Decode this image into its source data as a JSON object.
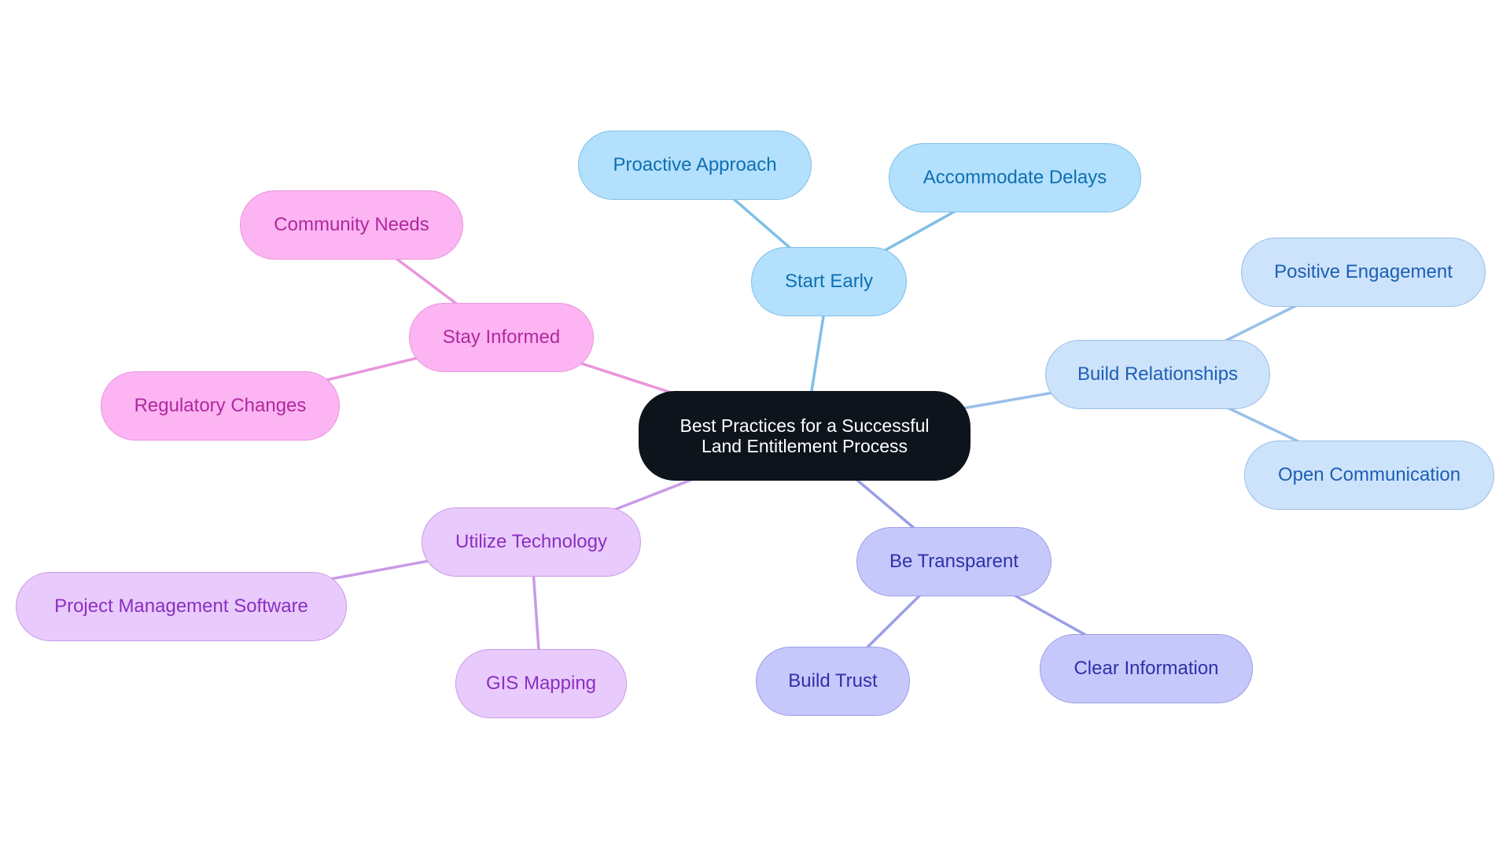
{
  "diagram": {
    "type": "mindmap",
    "root": {
      "id": "root",
      "label_lines": [
        "Best Practices for a Successful",
        "Land Entitlement Process"
      ],
      "theme": "dark"
    },
    "themes": {
      "dark": {
        "fill": "#0d141c",
        "stroke": "#0d141c",
        "text": "#ffffff",
        "edge": "#0d141c"
      },
      "sky": {
        "fill": "#b3e0fd",
        "stroke": "#7fbfe6",
        "text": "#0f6fb0",
        "edge": "#7fbfe6"
      },
      "azure": {
        "fill": "#cde3fb",
        "stroke": "#98bfe8",
        "text": "#1c5fb4",
        "edge": "#98bfe8"
      },
      "indigo": {
        "fill": "#c6c8fc",
        "stroke": "#9a9fe6",
        "text": "#2e30a8",
        "edge": "#9a9fe6"
      },
      "violet": {
        "fill": "#e9cafc",
        "stroke": "#c99be6",
        "text": "#8a2fc0",
        "edge": "#c99be6"
      },
      "pink": {
        "fill": "#fcb4f2",
        "stroke": "#e896dc",
        "text": "#b0289e",
        "edge": "#e896dc"
      }
    },
    "nodes": [
      {
        "id": "start-early",
        "label": "Start Early",
        "parent": "root",
        "theme": "sky"
      },
      {
        "id": "proactive-approach",
        "label": "Proactive Approach",
        "parent": "start-early",
        "theme": "sky"
      },
      {
        "id": "accommodate-delays",
        "label": "Accommodate Delays",
        "parent": "start-early",
        "theme": "sky"
      },
      {
        "id": "build-relationships",
        "label": "Build Relationships",
        "parent": "root",
        "theme": "azure"
      },
      {
        "id": "positive-engagement",
        "label": "Positive Engagement",
        "parent": "build-relationships",
        "theme": "azure"
      },
      {
        "id": "open-communication",
        "label": "Open Communication",
        "parent": "build-relationships",
        "theme": "azure"
      },
      {
        "id": "be-transparent",
        "label": "Be Transparent",
        "parent": "root",
        "theme": "indigo"
      },
      {
        "id": "build-trust",
        "label": "Build Trust",
        "parent": "be-transparent",
        "theme": "indigo"
      },
      {
        "id": "clear-information",
        "label": "Clear Information",
        "parent": "be-transparent",
        "theme": "indigo"
      },
      {
        "id": "utilize-technology",
        "label": "Utilize Technology",
        "parent": "root",
        "theme": "violet"
      },
      {
        "id": "project-management-software",
        "label": "Project Management Software",
        "parent": "utilize-technology",
        "theme": "violet"
      },
      {
        "id": "gis-mapping",
        "label": "GIS Mapping",
        "parent": "utilize-technology",
        "theme": "violet"
      },
      {
        "id": "stay-informed",
        "label": "Stay Informed",
        "parent": "root",
        "theme": "pink"
      },
      {
        "id": "community-needs",
        "label": "Community Needs",
        "parent": "stay-informed",
        "theme": "pink"
      },
      {
        "id": "regulatory-changes",
        "label": "Regulatory Changes",
        "parent": "stay-informed",
        "theme": "pink"
      }
    ]
  }
}
